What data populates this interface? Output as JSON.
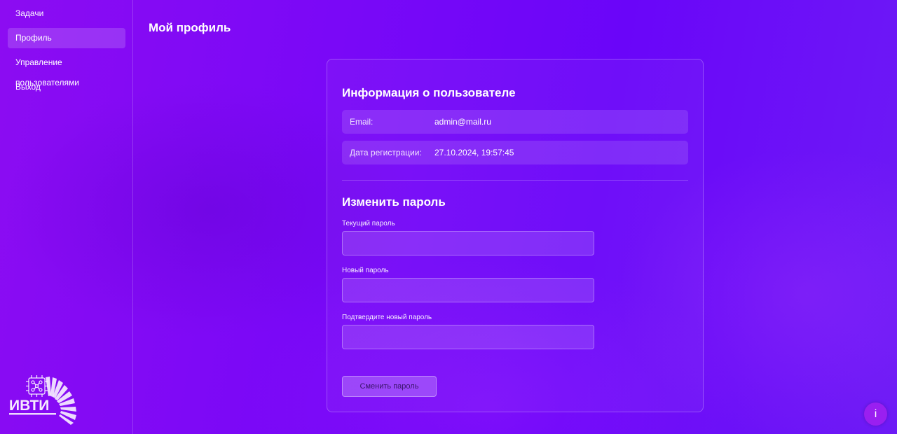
{
  "sidebar": {
    "items": [
      {
        "label": "Задачи",
        "active": false
      },
      {
        "label": "Профиль",
        "active": true
      },
      {
        "label": "Управление пользователями",
        "active": false
      },
      {
        "label": "Выход",
        "active": false
      }
    ],
    "logo_text": "ИВТИ"
  },
  "page": {
    "title": "Мой профиль"
  },
  "user_info": {
    "title": "Информация о пользователе",
    "email_label": "Email:",
    "email_value": "admin@mail.ru",
    "registered_label": "Дата регистрации:",
    "registered_value": "27.10.2024, 19:57:45"
  },
  "change_password": {
    "title": "Изменить пароль",
    "current_label": "Текущий пароль",
    "current_value": "",
    "new_label": "Новый пароль",
    "new_value": "",
    "confirm_label": "Подтвердите новый пароль",
    "confirm_value": "",
    "submit_label": "Сменить пароль"
  },
  "help_button": {
    "label": "i"
  },
  "colors": {
    "background_start": "#8c0cf2",
    "background_end": "#6d1bf6",
    "help_button": "#9a1ff0"
  }
}
